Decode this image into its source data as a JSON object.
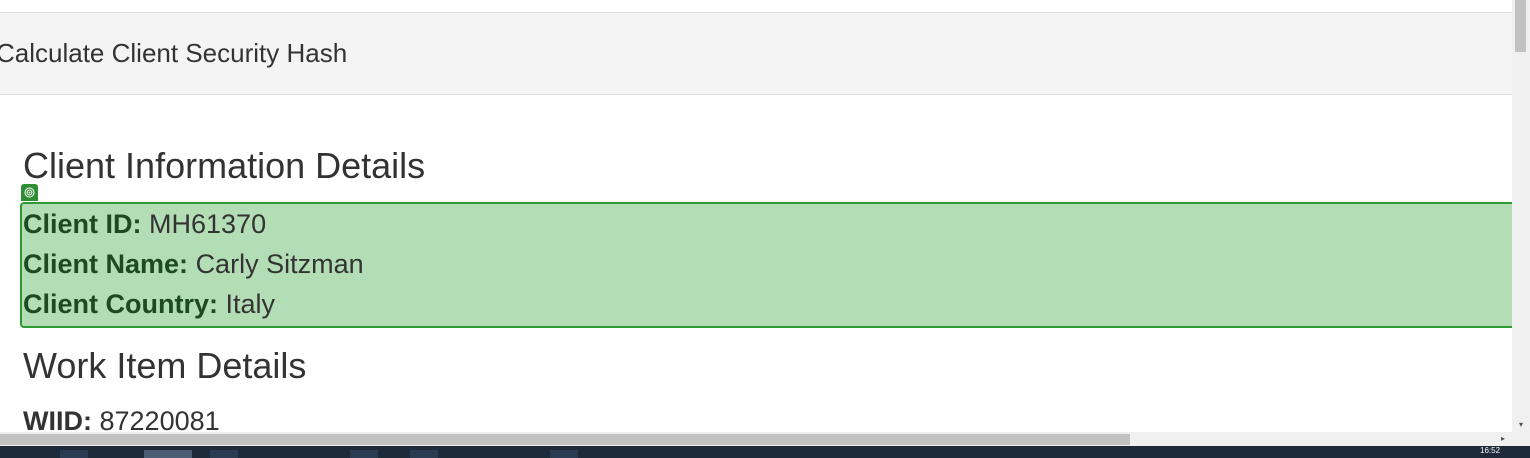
{
  "panel": {
    "title": "Calculate Client Security Hash"
  },
  "client_section": {
    "heading": "Client Information Details",
    "fields": [
      {
        "label": "Client ID:",
        "value": "MH61370"
      },
      {
        "label": "Client Name:",
        "value": "Carly Sitzman"
      },
      {
        "label": "Client Country:",
        "value": "Italy"
      }
    ]
  },
  "work_section": {
    "heading": "Work Item Details",
    "fields": [
      {
        "label": "WIID:",
        "value": "87220081"
      }
    ]
  },
  "highlight": {
    "icon": "target-icon",
    "fill_color": "#b3ddb5",
    "border_color": "#2e9a34"
  },
  "scrollbars": {
    "down_arrow": "▾",
    "right_arrow": "▸"
  },
  "taskbar": {
    "clock": "16:52"
  }
}
